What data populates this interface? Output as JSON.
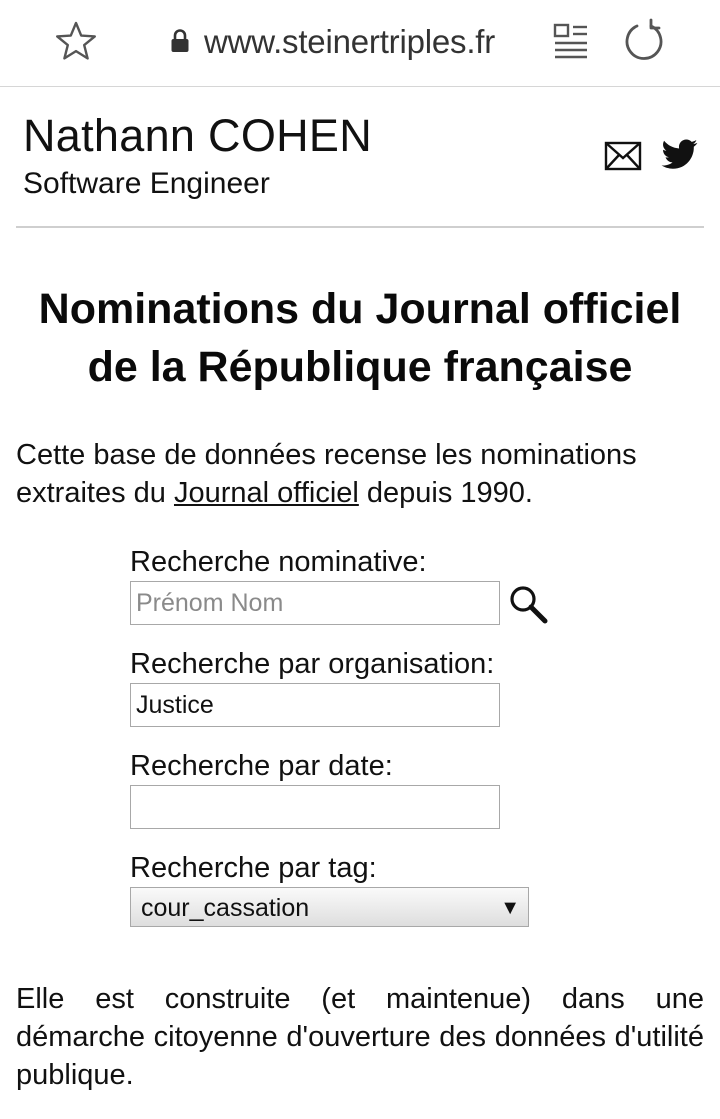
{
  "browser": {
    "url": "www.steinertriples.fr",
    "icons": {
      "bookmark": "star-outline-icon",
      "secure": "lock-icon",
      "reader_mode": "reader-mode-icon",
      "reload": "reload-icon"
    }
  },
  "header": {
    "name": "Nathann COHEN",
    "role": "Software Engineer",
    "icons": {
      "mail": "mail-icon",
      "twitter": "twitter-icon"
    }
  },
  "main": {
    "title": "Nominations du Journal officiel de la République française",
    "intro_before": "Cette base de données recense les nominations extraites du ",
    "intro_link": "Journal officiel",
    "intro_after": " depuis 1990.",
    "search": {
      "name_label": "Recherche nominative:",
      "name_placeholder": "Prénom Nom",
      "name_value": "",
      "org_label": "Recherche par organisation:",
      "org_value": "Justice",
      "date_label": "Recherche par date:",
      "date_value": "",
      "tag_label": "Recherche par tag:",
      "tag_value": "cour_cassation",
      "tag_arrow": "▼",
      "search_icon": "search-icon"
    },
    "outro": "Elle est construite (et maintenue) dans une démarche citoyenne d'ouverture des données d'utilité publique."
  }
}
